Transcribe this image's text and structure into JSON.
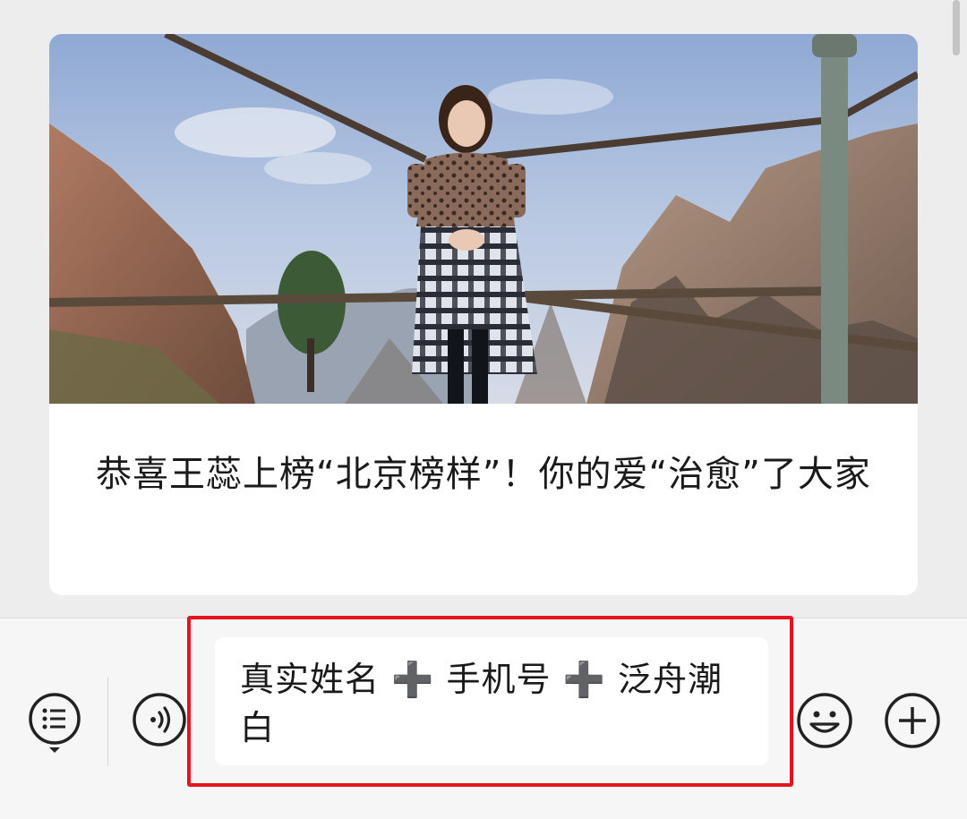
{
  "article_card": {
    "title": "恭喜王蕊上榜“北京榜样”！你的爱“治愈”了大家",
    "image_alt": "Woman standing by a railing on a mountain viewpoint"
  },
  "composer": {
    "input_value": "真实姓名 ➕ 手机号 ➕ 泛舟潮白"
  },
  "icons": {
    "menu": "list-menu-icon",
    "voice": "voice-icon",
    "emoji": "emoji-icon",
    "more": "plus-icon"
  },
  "colors": {
    "annotation": "#e8141b",
    "background": "#ededed",
    "toolbar": "#f6f6f6"
  }
}
